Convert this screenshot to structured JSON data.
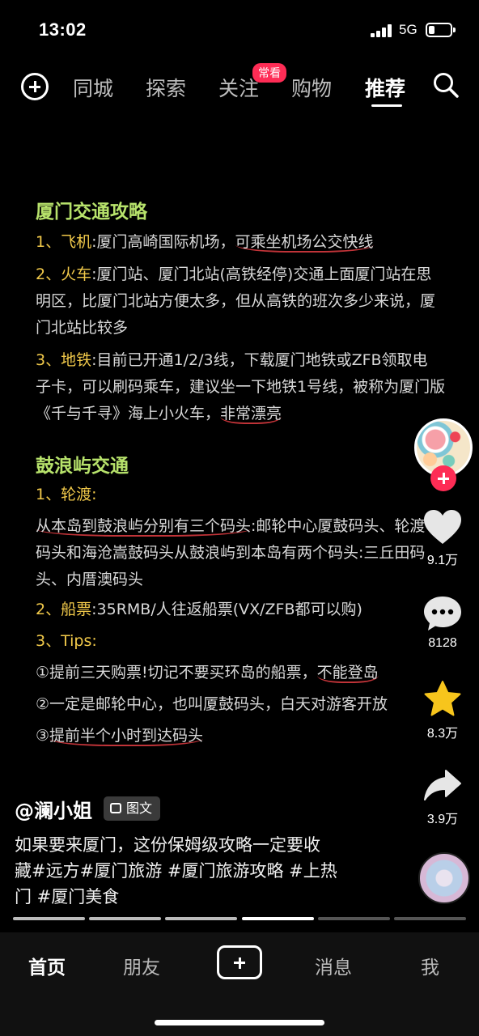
{
  "status_bar": {
    "time": "13:02",
    "network": "5G",
    "signal_icon": "signal-bars-icon",
    "battery_icon": "battery-icon",
    "battery_level": 0.25
  },
  "top_nav": {
    "add_icon": "plus-circle-icon",
    "tabs": [
      "同城",
      "探索",
      "关注",
      "购物",
      "推荐"
    ],
    "active_tab": "推荐",
    "badge": "常看",
    "search_icon": "search-icon"
  },
  "post": {
    "heading1": "厦门交通攻略",
    "air": {
      "num": "1、",
      "key": "飞机",
      "text": ":厦门高崎国际机场，",
      "mark": "可乘坐机场公交快线"
    },
    "train": {
      "num": "2、",
      "key": "火车",
      "line1": ":厦门站、厦门北站(高铁经停)交通上面厦门站在思",
      "line2": "明区，比厦门北站方便太多，但从高铁的班次多少来说，厦",
      "line3": "门北站比较多"
    },
    "metro": {
      "num": "3、",
      "key": "地铁",
      "line1": ":目前已开通1/2/3线，下载厦门地铁或ZFB领取电",
      "line2": "子卡，可以刷码乘车，建议坐一下地铁1号线，被称为厦门版",
      "line3a": "《千与千寻》海上小火车，",
      "line3b": "非常漂亮"
    },
    "heading2": "鼓浪屿交通",
    "ferry_title": "1、轮渡:",
    "ferry_line1a": "从本岛到鼓浪屿分别有三个码头",
    "ferry_line1b": ":邮轮中心厦鼓码头、轮渡",
    "ferry_line2": "码头和海沧嵩鼓码头从鼓浪屿到本岛有两个码头:三丘田码",
    "ferry_line3": "头、内厝澳码头",
    "ticket": {
      "num": "2、",
      "key": "船票",
      "text": ":35RMB/人往返船票(VX/ZFB都可以购)"
    },
    "tips_title": "3、Tips:",
    "tip1a": "①提前三天购票!切记不要买环岛的船票，",
    "tip1b": "不能登岛",
    "tip2": "②一定是邮轮中心，也叫厦鼓码头，白天对游客开放",
    "tip3a": "③",
    "tip3b": "提前半个小时到达码头"
  },
  "actions": {
    "avatar_icon": "author-avatar",
    "follow_icon": "follow-plus-icon",
    "like": {
      "icon": "heart-icon",
      "count": "9.1万"
    },
    "comment": {
      "icon": "comment-icon",
      "count": "8128"
    },
    "favorite": {
      "icon": "star-icon",
      "count": "8.3万",
      "color": "#f7c51c"
    },
    "share": {
      "icon": "share-icon",
      "count": "3.9万"
    },
    "music_icon": "music-disc-icon"
  },
  "info": {
    "author": "@澜小姐",
    "type_chip": "图文",
    "desc_line1": "如果要来厦门，这份保姆级攻略一定要收",
    "desc_line2": "藏#远方#厦门旅游 #厦门旅游攻略 #上热",
    "desc_line3": "门 #厦门美食",
    "image_count": 6,
    "current_image": 4
  },
  "bottom_tabs": {
    "home": "首页",
    "friends": "朋友",
    "add_icon": "create-plus-icon",
    "messages": "消息",
    "me": "我",
    "active": "首页"
  },
  "colors": {
    "heading": "#b7e26b",
    "highlight": "#f1c94a",
    "underline": "#c03338",
    "badge": "#fe2c55"
  }
}
